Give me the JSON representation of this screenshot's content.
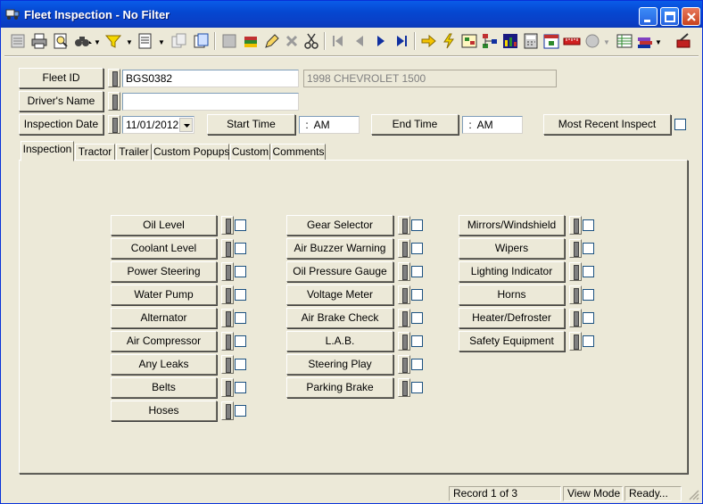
{
  "window": {
    "title": "Fleet Inspection - No Filter",
    "icon": "truck-icon"
  },
  "toolbar": {
    "icons": [
      "list-icon",
      "print-icon",
      "print-preview-icon",
      "binoculars-icon",
      "filter-icon",
      "report-icon",
      "copy-icon",
      "new-record-icon",
      "stamp-icon",
      "books-icon",
      "pencil-icon",
      "delete-icon",
      "scissors-icon",
      "first-record-icon",
      "previous-record-icon",
      "next-record-icon",
      "last-record-icon",
      "goto-icon",
      "lightning-icon",
      "explorer-icon",
      "tree-icon",
      "chart-icon",
      "calculator-icon",
      "calendar-icon",
      "ruler-icon",
      "globe-icon",
      "notes-icon",
      "books-stack-icon",
      "exit-icon"
    ]
  },
  "header": {
    "fleet_id_label": "Fleet ID",
    "fleet_id_value": "BGS0382",
    "vehicle_desc": "1998 CHEVROLET 1500",
    "drivers_name_label": "Driver's Name",
    "drivers_name_value": "",
    "inspection_date_label": "Inspection Date",
    "inspection_date_value": "11/01/2012",
    "start_time_label": "Start Time",
    "start_time_value": " :  AM",
    "end_time_label": "End Time",
    "end_time_value": " :  AM",
    "most_recent_label": "Most Recent Inspect"
  },
  "tabs": [
    "Inspection",
    "Tractor",
    "Trailer",
    "Custom Popups",
    "Custom",
    "Comments"
  ],
  "active_tab": "Inspection",
  "inspection": {
    "col1": [
      "Oil Level",
      "Coolant Level",
      "Power Steering",
      "Water Pump",
      "Alternator",
      "Air Compressor",
      "Any Leaks",
      "Belts",
      "Hoses"
    ],
    "col2": [
      "Gear Selector",
      "Air Buzzer Warning",
      "Oil Pressure Gauge",
      "Voltage Meter",
      "Air Brake Check",
      "L.A.B.",
      "Steering Play",
      "Parking Brake"
    ],
    "col3": [
      "Mirrors/Windshield",
      "Wipers",
      "Lighting Indicator",
      "Horns",
      "Heater/Defroster",
      "Safety Equipment"
    ]
  },
  "status": {
    "record": "Record 1 of 3",
    "mode": "View Mode",
    "state": "Ready..."
  }
}
